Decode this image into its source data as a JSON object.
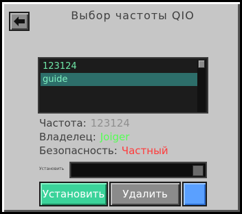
{
  "window": {
    "title": "Выбор частоты QIO"
  },
  "list": {
    "items": [
      {
        "label": "123124",
        "selected": false
      },
      {
        "label": "guide",
        "selected": true
      }
    ]
  },
  "info": {
    "frequency_label": "Частота:",
    "frequency_value": "123124",
    "owner_label": "Владелец:",
    "owner_value": "Joiger",
    "security_label": "Безопасность:",
    "security_value": "Частный"
  },
  "input": {
    "label": "Установить",
    "value": ""
  },
  "buttons": {
    "set_label": "Установить",
    "delete_label": "Удалить"
  },
  "colors": {
    "accent_green": "#3bd39a",
    "owner_green": "#55ff55",
    "security_red": "#ff3b3b",
    "color_swatch": "#5aa0ff",
    "selected_row": "#2d6e6a"
  },
  "icons": {
    "back": "arrow-left-icon",
    "check": "checkmark-icon"
  }
}
